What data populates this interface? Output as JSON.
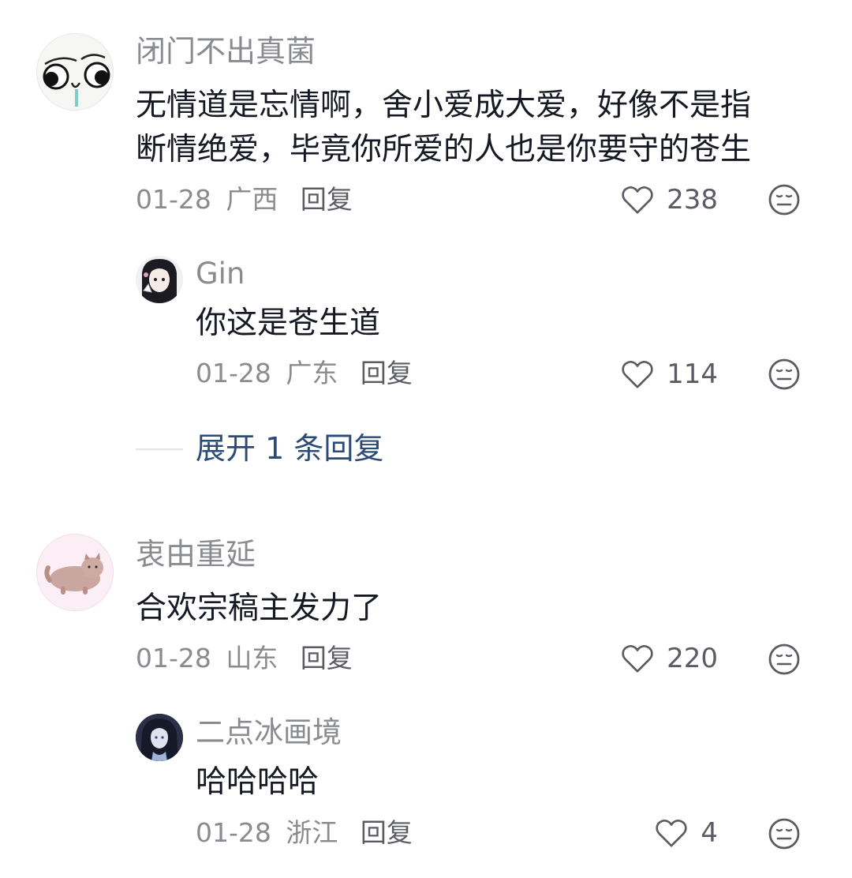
{
  "comments": [
    {
      "author": "闭门不出真菌",
      "text_lines": [
        "无情道是忘情啊，舍小爱成大爱，好像不是指",
        "断情绝爱，毕竟你所爱的人也是你要守的苍生"
      ],
      "date": "01-28",
      "location": "广西",
      "reply_label": "回复",
      "likes": "238",
      "avatar_icon": "cartoon-face-avatar",
      "replies": [
        {
          "author": "Gin",
          "text": "你这是苍生道",
          "date": "01-28",
          "location": "广东",
          "reply_label": "回复",
          "likes": "114",
          "avatar_icon": "anime-girl-avatar"
        }
      ],
      "expand_label": "展开 1 条回复"
    },
    {
      "author": "衷由重延",
      "text_lines": [
        "合欢宗稿主发力了"
      ],
      "date": "01-28",
      "location": "山东",
      "reply_label": "回复",
      "likes": "220",
      "avatar_icon": "cat-avatar",
      "replies": [
        {
          "author": "二点冰画境",
          "text": "哈哈哈哈",
          "date": "01-28",
          "location": "浙江",
          "reply_label": "回复",
          "likes": "4",
          "avatar_icon": "dark-hair-girl-avatar"
        }
      ]
    }
  ],
  "icons": {
    "like": "heart-outline-icon",
    "dislike": "meh-face-icon"
  },
  "colors": {
    "text": "#161823",
    "muted": "#8a8b91",
    "link": "#2b4b76",
    "icon": "#5b5c63"
  }
}
